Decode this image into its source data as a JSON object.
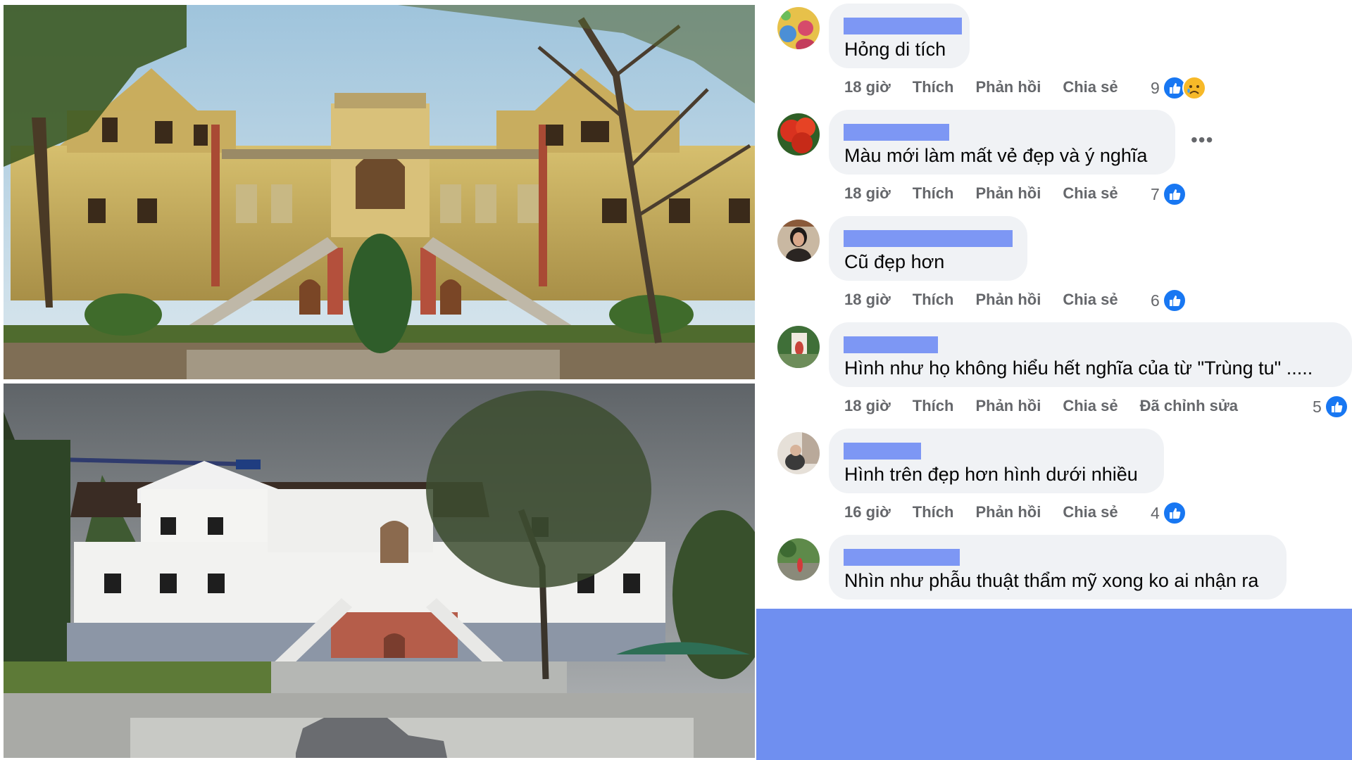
{
  "comments": [
    {
      "text": "Hỏng di tích",
      "time": "18 giờ",
      "like": "Thích",
      "reply": "Phản hồi",
      "share": "Chia sẻ",
      "edited": "",
      "reaction_count": "9",
      "reactions": [
        "like-icon",
        "sad-icon"
      ],
      "has_more_menu": false
    },
    {
      "text": "Màu mới làm mất vẻ đẹp và ý nghĩa",
      "time": "18 giờ",
      "like": "Thích",
      "reply": "Phản hồi",
      "share": "Chia sẻ",
      "edited": "",
      "reaction_count": "7",
      "reactions": [
        "like-icon"
      ],
      "has_more_menu": true,
      "more_menu": "•••"
    },
    {
      "text": "Cũ đẹp hơn",
      "time": "18 giờ",
      "like": "Thích",
      "reply": "Phản hồi",
      "share": "Chia sẻ",
      "edited": "",
      "reaction_count": "6",
      "reactions": [
        "like-icon"
      ],
      "has_more_menu": false
    },
    {
      "text": "Hình như họ không hiểu hết nghĩa của từ \"Trùng tu\" .....",
      "time": "18 giờ",
      "like": "Thích",
      "reply": "Phản hồi",
      "share": "Chia sẻ",
      "edited": "Đã chỉnh sửa",
      "reaction_count": "5",
      "reactions": [
        "like-icon"
      ],
      "has_more_menu": false
    },
    {
      "text": "Hình trên đẹp hơn hình dưới nhiều",
      "time": "16 giờ",
      "like": "Thích",
      "reply": "Phản hồi",
      "share": "Chia sẻ",
      "edited": "",
      "reaction_count": "4",
      "reactions": [
        "like-icon"
      ],
      "has_more_menu": false
    },
    {
      "text": "Nhìn như phẫu thuật thẩm mỹ xong ko ai nhận ra",
      "time": "",
      "like": "",
      "reply": "",
      "share": "",
      "edited": "",
      "reaction_count": "",
      "reactions": [],
      "has_more_menu": false
    }
  ],
  "colors": {
    "name_redaction": "#7d97f4",
    "bottom_fill": "#6f8ff0",
    "bubble": "#f0f2f5",
    "like_blue": "#1877f2"
  }
}
